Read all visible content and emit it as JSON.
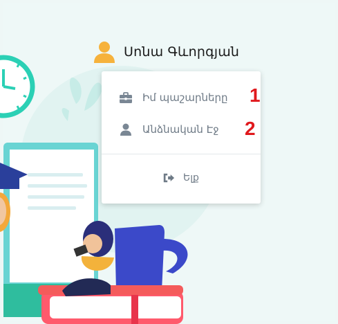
{
  "user": {
    "name": "Սոնա Գևորգյան",
    "icon": "user-icon"
  },
  "menu": {
    "items": [
      {
        "label": "Իմ պաշարները",
        "icon": "briefcase-icon",
        "marker": "1"
      },
      {
        "label": "Անձնական Էջ",
        "icon": "user-icon",
        "marker": "2"
      }
    ],
    "logout": {
      "label": "Ելք",
      "icon": "sign-out-icon"
    }
  },
  "colors": {
    "accent_orange": "#f6b23c",
    "menu_text": "#6e7a86",
    "marker_red": "#e0191d",
    "teal": "#2ec4b6"
  }
}
